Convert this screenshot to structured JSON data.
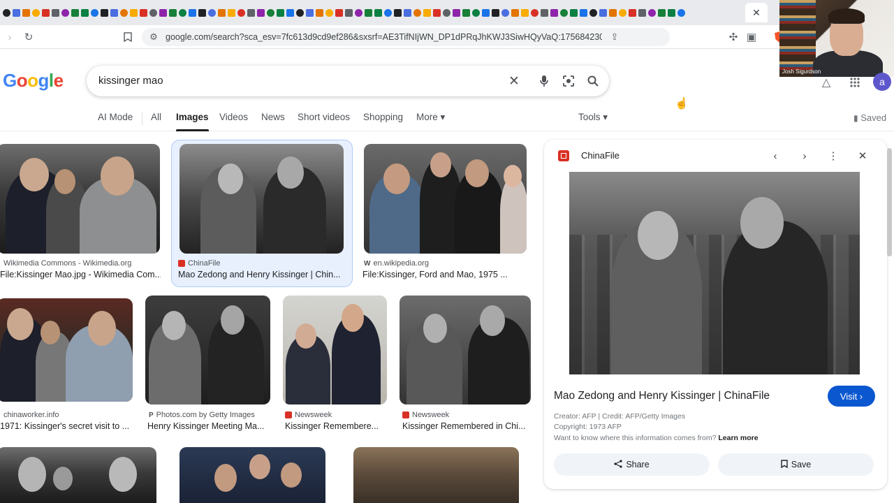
{
  "browser": {
    "url": "google.com/search?sca_esv=7fc613d9cd9ef286&sxsrf=AE3TifNIjWN_DP1dPRqJhKWJ3SiwHQyVaQ:175684230430...",
    "active_tab_close": "✕"
  },
  "webcam": {
    "name": "Josh Sigurdson"
  },
  "google": {
    "logo": "Google",
    "query": "kissinger mao",
    "avatar_letter": "a"
  },
  "tabs": {
    "ai_mode": "AI Mode",
    "all": "All",
    "images": "Images",
    "videos": "Videos",
    "news": "News",
    "short_videos": "Short videos",
    "shopping": "Shopping",
    "more": "More ▾",
    "tools": "Tools ▾",
    "saved": "Saved"
  },
  "results": [
    {
      "source": "Wikimedia Commons - Wikimedia.org",
      "title": "File:Kissinger Mao.jpg - Wikimedia Com..."
    },
    {
      "source": "ChinaFile",
      "title": "Mao Zedong and Henry Kissinger | Chin..."
    },
    {
      "source": "en.wikipedia.org",
      "title": "File:Kissinger, Ford and Mao, 1975 ..."
    },
    {
      "source": "chinaworker.info",
      "title": "1971: Kissinger's secret visit to ..."
    },
    {
      "source": "Photos.com by Getty Images",
      "title": "Henry Kissinger Meeting Ma..."
    },
    {
      "source": "Newsweek",
      "title": "Kissinger Remembere..."
    },
    {
      "source": "Newsweek",
      "title": "Kissinger Remembered in Chi..."
    }
  ],
  "panel": {
    "source": "ChinaFile",
    "title": "Mao Zedong and Henry Kissinger | ChinaFile",
    "visit": "Visit ›",
    "creator": "Creator: AFP | Credit: AFP/Getty Images",
    "copyright": "Copyright: 1973 AFP",
    "info_prompt": "Want to know where this information comes from?",
    "learn_more": "Learn more",
    "share": "Share",
    "save": "Save"
  },
  "colors": {
    "accent": "#0b57d0",
    "brand_red": "#d93025",
    "selected_bg": "#e8f0fe"
  }
}
